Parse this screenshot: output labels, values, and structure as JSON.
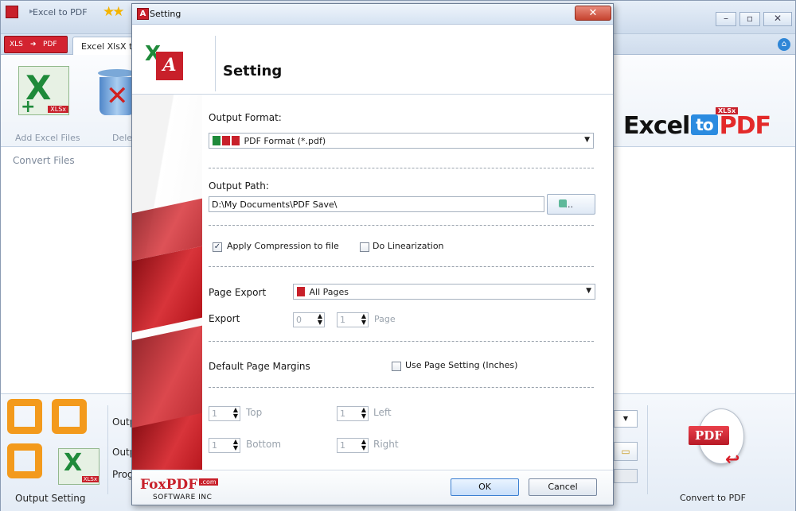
{
  "app": {
    "title": "Excel to PDF",
    "tab_label": "Excel XlsX to",
    "ribbon": {
      "add_label": "Add Excel Files",
      "delete_label": "Dele"
    },
    "convert_files_label": "Convert Files",
    "brand": {
      "excel": "Excel",
      "to": "to",
      "pdf": "PDF",
      "badge": "XLSx"
    },
    "bottom": {
      "output_setting_label": "Output Setting",
      "row1": "Outp",
      "row2": "Outp",
      "row3": "Prog",
      "convert_label": "Convert to PDF",
      "xlsx_badge": "XLSx",
      "pdf_tag": "PDF"
    }
  },
  "dialog": {
    "title": "Setting",
    "header_title": "Setting",
    "output_format": {
      "label": "Output Format:",
      "value": "PDF Format (*.pdf)"
    },
    "output_path": {
      "label": "Output Path:",
      "value": "D:\\My Documents\\PDF Save\\",
      "browse_label": "...."
    },
    "compression": {
      "label": "Apply Compression to file",
      "checked": true
    },
    "linearization": {
      "label": "Do Linearization",
      "checked": false
    },
    "page_export": {
      "label": "Page Export",
      "value": "All Pages"
    },
    "export": {
      "label": "Export",
      "from": "0",
      "to": "1",
      "suffix": "Page"
    },
    "default_margins": {
      "label": "Default Page Margins"
    },
    "use_page_setting": {
      "label": "Use Page Setting (Inches)",
      "checked": false
    },
    "margins": {
      "top": {
        "label": "Top",
        "value": "1"
      },
      "left": {
        "label": "Left",
        "value": "1"
      },
      "bottom": {
        "label": "Bottom",
        "value": "1"
      },
      "right": {
        "label": "Right",
        "value": "1"
      }
    },
    "footer": {
      "brand": "FoxPDF",
      "brand_com": ".com",
      "brand_sub": "SOFTWARE INC",
      "ok_label": "OK",
      "cancel_label": "Cancel"
    }
  },
  "colors": {
    "accent_red": "#c8202a",
    "excel_green": "#1f8a3a",
    "brand_blue": "#2b8be0"
  }
}
